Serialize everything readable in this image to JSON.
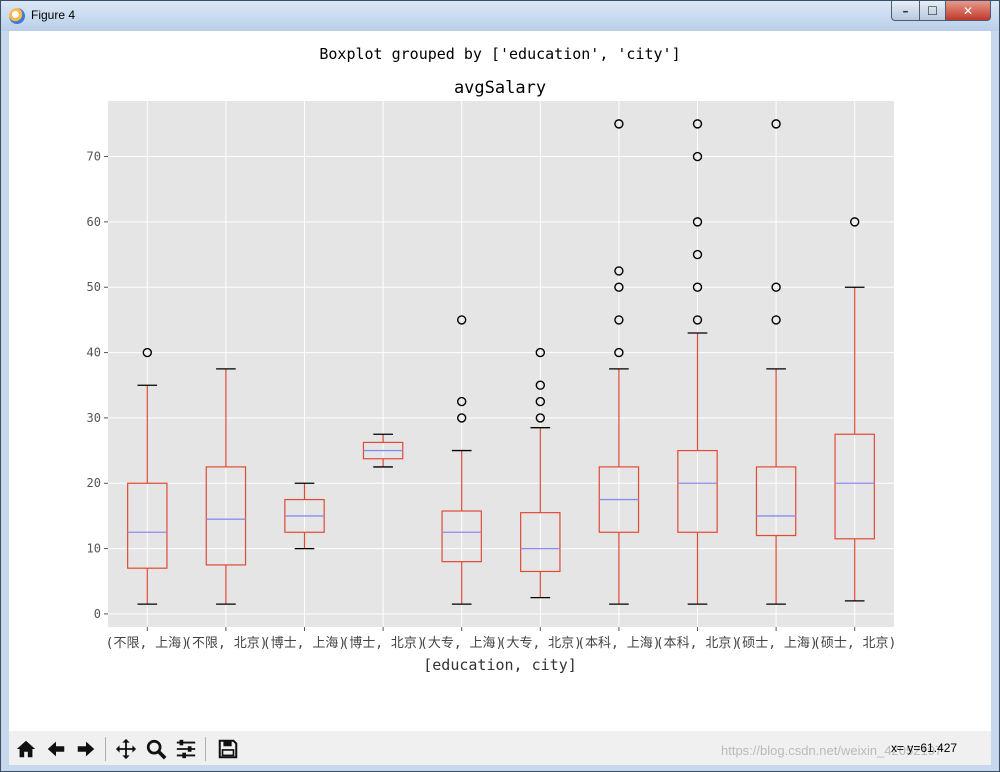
{
  "window": {
    "title": "Figure 4",
    "min_label": "–",
    "max_label": "☐",
    "close_label": "✕"
  },
  "toolbar": {
    "items": [
      {
        "name": "home-button",
        "icon": "home-icon"
      },
      {
        "name": "back-button",
        "icon": "arrow-left-icon"
      },
      {
        "name": "forward-button",
        "icon": "arrow-right-icon"
      },
      {
        "name": "pan-button",
        "icon": "move-icon"
      },
      {
        "name": "zoom-button",
        "icon": "magnifier-icon"
      },
      {
        "name": "subplots-button",
        "icon": "sliders-icon"
      },
      {
        "name": "save-button",
        "icon": "floppy-icon"
      }
    ],
    "coords": "x= y=61.427",
    "watermark": "https://blog.csdn.net/weixin_42052197"
  },
  "chart_data": {
    "type": "box",
    "suptitle": "Boxplot grouped by ['education', 'city']",
    "title": "avgSalary",
    "xlabel": "[education, city]",
    "ylabel": "",
    "ylim": [
      -2,
      78.5
    ],
    "yticks": [
      0,
      10,
      20,
      30,
      40,
      50,
      60,
      70
    ],
    "grid": true,
    "colors": {
      "box": "#e24a33",
      "median": "#8c8cf0",
      "whisker_cap": "#000000",
      "axes_bg": "#e5e5e5",
      "grid": "#ffffff"
    },
    "categories": [
      "(不限, 上海)",
      "(不限, 北京)",
      "(博士, 上海)",
      "(博士, 北京)",
      "(大专, 上海)",
      "(大专, 北京)",
      "(本科, 上海)",
      "(本科, 北京)",
      "(硕士, 上海)",
      "(硕士, 北京)"
    ],
    "boxes": [
      {
        "whislo": 1.5,
        "q1": 7,
        "med": 12.5,
        "q3": 20,
        "whishi": 35,
        "fliers": [
          40
        ]
      },
      {
        "whislo": 1.5,
        "q1": 7.5,
        "med": 14.5,
        "q3": 22.5,
        "whishi": 37.5,
        "fliers": []
      },
      {
        "whislo": 10,
        "q1": 12.5,
        "med": 15,
        "q3": 17.5,
        "whishi": 20,
        "fliers": []
      },
      {
        "whislo": 22.5,
        "q1": 23.75,
        "med": 25,
        "q3": 26.25,
        "whishi": 27.5,
        "fliers": []
      },
      {
        "whislo": 1.5,
        "q1": 8,
        "med": 12.5,
        "q3": 15.75,
        "whishi": 25,
        "fliers": [
          30,
          32.5,
          45
        ]
      },
      {
        "whislo": 2.5,
        "q1": 6.5,
        "med": 10,
        "q3": 15.5,
        "whishi": 28.5,
        "fliers": [
          30,
          32.5,
          35,
          40
        ]
      },
      {
        "whislo": 1.5,
        "q1": 12.5,
        "med": 17.5,
        "q3": 22.5,
        "whishi": 37.5,
        "fliers": [
          40,
          45,
          50,
          52.5,
          75
        ]
      },
      {
        "whislo": 1.5,
        "q1": 12.5,
        "med": 20,
        "q3": 25,
        "whishi": 43,
        "fliers": [
          45,
          50,
          55,
          60,
          70,
          75
        ]
      },
      {
        "whislo": 1.5,
        "q1": 12,
        "med": 15,
        "q3": 22.5,
        "whishi": 37.5,
        "fliers": [
          45,
          50,
          75
        ]
      },
      {
        "whislo": 2,
        "q1": 11.5,
        "med": 20,
        "q3": 27.5,
        "whishi": 50,
        "fliers": [
          60
        ]
      }
    ]
  }
}
